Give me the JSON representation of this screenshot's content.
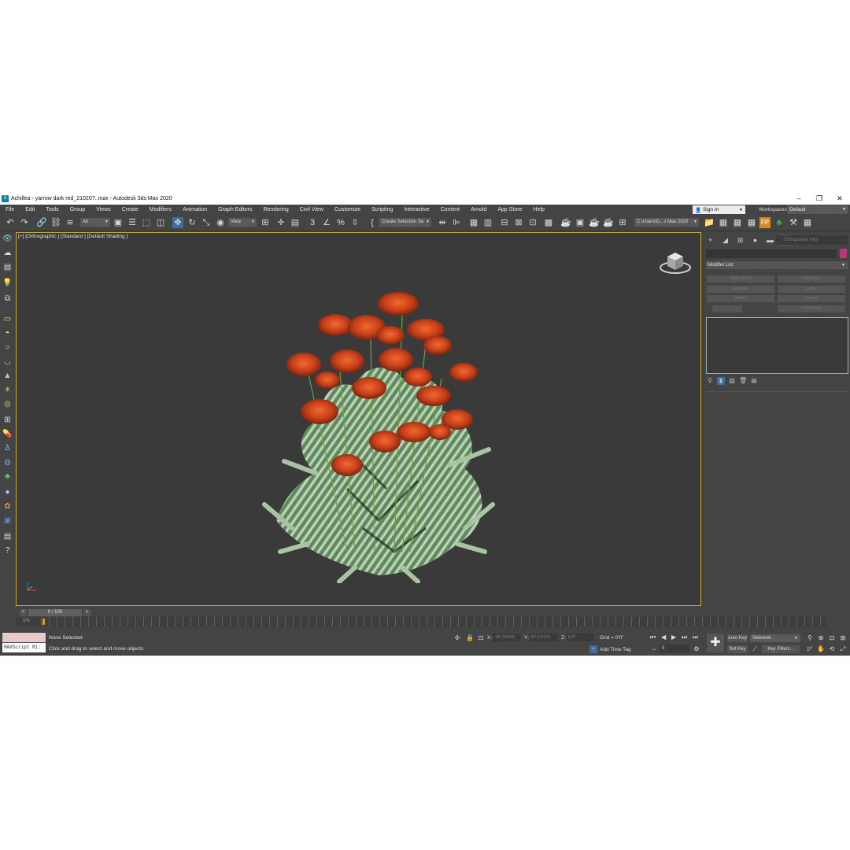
{
  "window": {
    "title": "Achillea - yarrow dark red_210207..max - Autodesk 3ds Max 2020",
    "minimize": "–",
    "maximize": "❐",
    "close": "✕"
  },
  "menu": [
    "File",
    "Edit",
    "Tools",
    "Group",
    "Views",
    "Create",
    "Modifiers",
    "Animation",
    "Graph Editors",
    "Rendering",
    "Civil View",
    "Customize",
    "Scripting",
    "Interactive",
    "Content",
    "Arnold",
    "App Store",
    "Help"
  ],
  "account": {
    "signin_label": "Sign In",
    "workspaces_label": "Workspaces:",
    "workspace_value": "Default"
  },
  "toolbar": {
    "filter_value": "All",
    "refcoord_value": "View",
    "selection_set_value": "Create Selection Se",
    "project_path": "C:\\Users\\D...s Max 2020"
  },
  "viewport": {
    "label": "[+] [Orthographic ] [Standard ] [Default Shading ]"
  },
  "command_panel": {
    "search_placeholder": "Extrapolate Vary",
    "modifier_list_label": "Modifier List",
    "object_color": "#c0307c",
    "modifier_buttons": [
      "FFD 2x2x2",
      "Edit Poly",
      "Extrude",
      "Lattice",
      "Bevel",
      "Sweep",
      "",
      "UVW Map"
    ]
  },
  "time": {
    "slider_label": "0 / 100",
    "prev_label": "<",
    "next_label": ">",
    "track_label": "1%"
  },
  "status": {
    "listener_label": "MAXScript Mi:",
    "selection_text": "None Selected",
    "prompt_text": "Click and drag to select and move objects",
    "x_label": "X:",
    "x_value": "-25.74/101",
    "y_label": "Y:",
    "y_value": "87.57/101",
    "z_label": "Z:",
    "z_value": "0.0\"",
    "grid_text": "Grid = 0'0\"",
    "add_time_tag": "Add Time Tag",
    "frame_value": "0",
    "auto_key_label": "Auto Key",
    "set_key_label": "Set Key",
    "selected_value": "Selected",
    "key_filters_label": "Key Filters..."
  }
}
